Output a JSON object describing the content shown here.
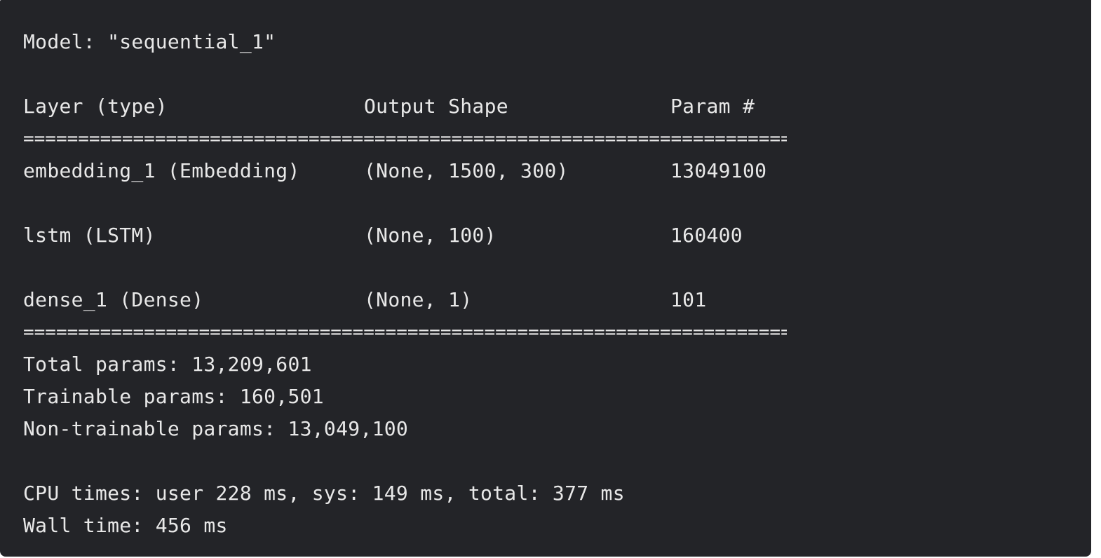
{
  "model_line": "Model: \"sequential_1\"",
  "rule_dash": "________________________________________________________________________________________________________________________",
  "rule_eq": "========================================================================================================================",
  "header": {
    "layer": "Layer (type)",
    "shape": "Output Shape",
    "param": "Param #"
  },
  "layers": [
    {
      "layer": "embedding_1 (Embedding)",
      "shape": "(None, 1500, 300)",
      "param": "13049100"
    },
    {
      "layer": "lstm (LSTM)",
      "shape": "(None, 100)",
      "param": "160400"
    },
    {
      "layer": "dense_1 (Dense)",
      "shape": "(None, 1)",
      "param": "101"
    }
  ],
  "summary": {
    "total": "Total params: 13,209,601",
    "trainable": "Trainable params: 160,501",
    "non_trainable": "Non-trainable params: 13,049,100"
  },
  "timing": {
    "cpu": "CPU times: user 228 ms, sys: 149 ms, total: 377 ms",
    "wall": "Wall time: 456 ms"
  }
}
